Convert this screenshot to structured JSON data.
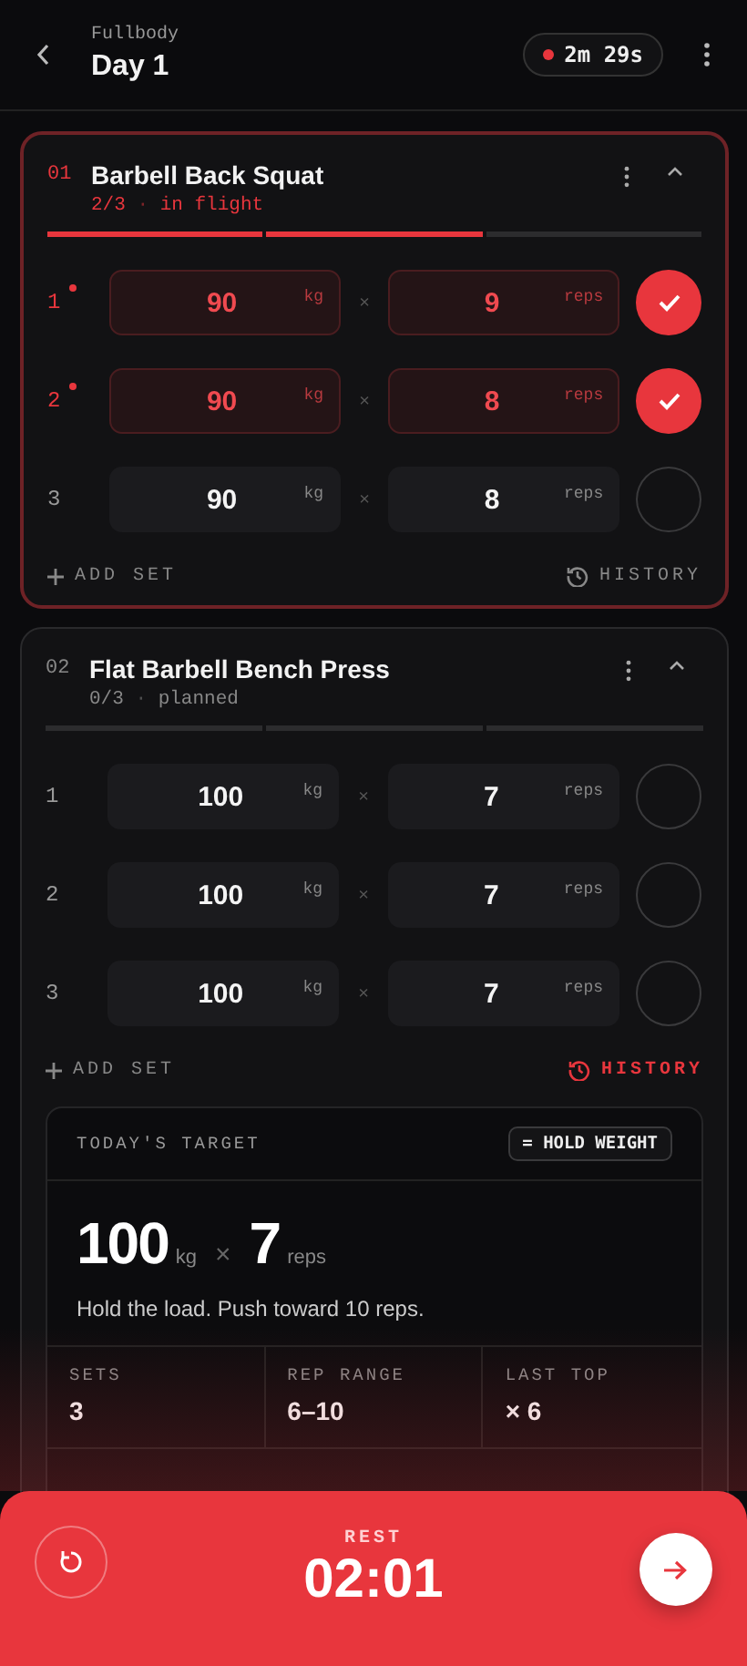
{
  "header": {
    "subtitle": "Fullbody",
    "title": "Day 1",
    "timer": {
      "text": "2m 29s",
      "recording": true
    }
  },
  "exercises": [
    {
      "index": "01",
      "name": "Barbell Back Squat",
      "progress": "2/3",
      "separator": "·",
      "status": "in flight",
      "active": true,
      "expanded": true,
      "segments": [
        {
          "done": true
        },
        {
          "done": true
        },
        {
          "done": false
        }
      ],
      "sets": [
        {
          "number": "1",
          "weight": "90",
          "weight_unit": "kg",
          "times": "×",
          "reps": "9",
          "reps_unit": "reps",
          "done": true,
          "marked": true
        },
        {
          "number": "2",
          "weight": "90",
          "weight_unit": "kg",
          "times": "×",
          "reps": "8",
          "reps_unit": "reps",
          "done": true,
          "marked": true
        },
        {
          "number": "3",
          "weight": "90",
          "weight_unit": "kg",
          "times": "×",
          "reps": "8",
          "reps_unit": "reps",
          "done": false,
          "marked": false
        }
      ],
      "add_set": "ADD SET",
      "history": {
        "label": "HISTORY",
        "selected": false
      }
    },
    {
      "index": "02",
      "name": "Flat Barbell Bench Press",
      "progress": "0/3",
      "separator": "·",
      "status": "planned",
      "active": false,
      "expanded": true,
      "segments": [
        {
          "done": false
        },
        {
          "done": false
        },
        {
          "done": false
        }
      ],
      "sets": [
        {
          "number": "1",
          "weight": "100",
          "weight_unit": "kg",
          "times": "×",
          "reps": "7",
          "reps_unit": "reps",
          "done": false,
          "marked": false
        },
        {
          "number": "2",
          "weight": "100",
          "weight_unit": "kg",
          "times": "×",
          "reps": "7",
          "reps_unit": "reps",
          "done": false,
          "marked": false
        },
        {
          "number": "3",
          "weight": "100",
          "weight_unit": "kg",
          "times": "×",
          "reps": "7",
          "reps_unit": "reps",
          "done": false,
          "marked": false
        }
      ],
      "add_set": "ADD SET",
      "history": {
        "label": "HISTORY",
        "selected": true
      },
      "target": {
        "label": "TODAY'S TARGET",
        "badge": "= HOLD WEIGHT",
        "weight": "100",
        "weight_unit": "kg",
        "times": "×",
        "reps": "7",
        "reps_unit": "reps",
        "note": "Hold the load. Push toward 10 reps.",
        "stats": [
          {
            "label": "SETS",
            "value": "3"
          },
          {
            "label": "REP RANGE",
            "value": "6–10"
          },
          {
            "label": "LAST TOP",
            "value": "× 6"
          }
        ]
      }
    }
  ],
  "rest": {
    "label": "REST",
    "time": "02:01"
  }
}
